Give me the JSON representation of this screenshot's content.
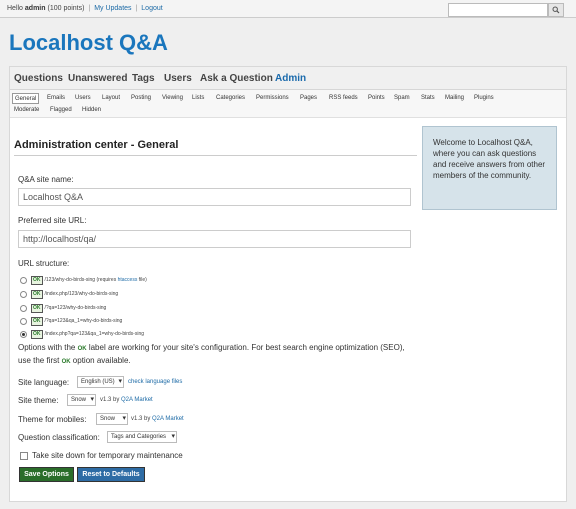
{
  "user_bar": {
    "hello": "Hello",
    "username": "admin",
    "points": "(100 points)",
    "my_updates": "My Updates",
    "logout": "Logout"
  },
  "search": {
    "placeholder": ""
  },
  "site_title": "Localhost Q&A",
  "main_nav": [
    "Questions",
    "Unanswered",
    "Tags",
    "Users",
    "Ask a Question",
    "Admin"
  ],
  "admin_nav": [
    "General",
    "Emails",
    "Users",
    "Layout",
    "Posting",
    "Viewing",
    "Lists",
    "Categories",
    "Permissions",
    "Pages",
    "RSS feeds",
    "Points",
    "Spam",
    "Stats",
    "Mailing",
    "Plugins",
    "Moderate",
    "Flagged",
    "Hidden"
  ],
  "page_heading": "Administration center - General",
  "form": {
    "site_name_label": "Q&A site name:",
    "site_name_value": "Localhost Q&A",
    "site_url_label": "Preferred site URL:",
    "site_url_value": "http://localhost/qa/",
    "url_structure_label": "URL structure:",
    "ok_badge": "OK",
    "url_options": [
      {
        "text": "/123/why-do-birds-sing (requires ",
        "link": "htaccess",
        "suffix": " file)",
        "checked": false
      },
      {
        "text": "/index.php/123/why-do-birds-sing",
        "link": "",
        "suffix": "",
        "checked": false
      },
      {
        "text": "/?qa=123/why-do-birds-sing",
        "link": "",
        "suffix": "",
        "checked": false
      },
      {
        "text": "/?qa=123&qa_1=why-do-birds-sing",
        "link": "",
        "suffix": "",
        "checked": false
      },
      {
        "text": "/index.php?qa=123&qa_1=why-do-birds-sing",
        "link": "",
        "suffix": "",
        "checked": true
      }
    ],
    "url_note_before": "Options with the ",
    "url_note_ok": "OK",
    "url_note_after": " label are working for your site's configuration. For best search engine optimization (SEO), use the first ",
    "url_note_ok2": "OK",
    "url_note_end": " option available.",
    "language_label": "Site language:",
    "language_value": "English (US)",
    "language_link": "check language files",
    "theme_label": "Site theme:",
    "theme_value": "Snow",
    "theme_version": "v1.3 by ",
    "theme_author": "Q2A Market",
    "mobile_theme_label": "Theme for mobiles:",
    "mobile_theme_value": "Snow",
    "mobile_theme_version": "v1.3 by ",
    "mobile_theme_author": "Q2A Market",
    "classification_label": "Question classification:",
    "classification_value": "Tags and Categories",
    "maintenance_label": "Take site down for temporary maintenance",
    "maintenance_checked": false,
    "save_button": "Save Options",
    "reset_button": "Reset to Defaults"
  },
  "sidebar": {
    "welcome": "Welcome to Localhost Q&A, where you can ask questions and receive answers from other members of the community."
  },
  "colors": {
    "title": "#1a76bd",
    "save_button": "#2a6d2a",
    "reset_button": "#2e6ca5",
    "sidebar_bg": "#d6e3ea"
  }
}
